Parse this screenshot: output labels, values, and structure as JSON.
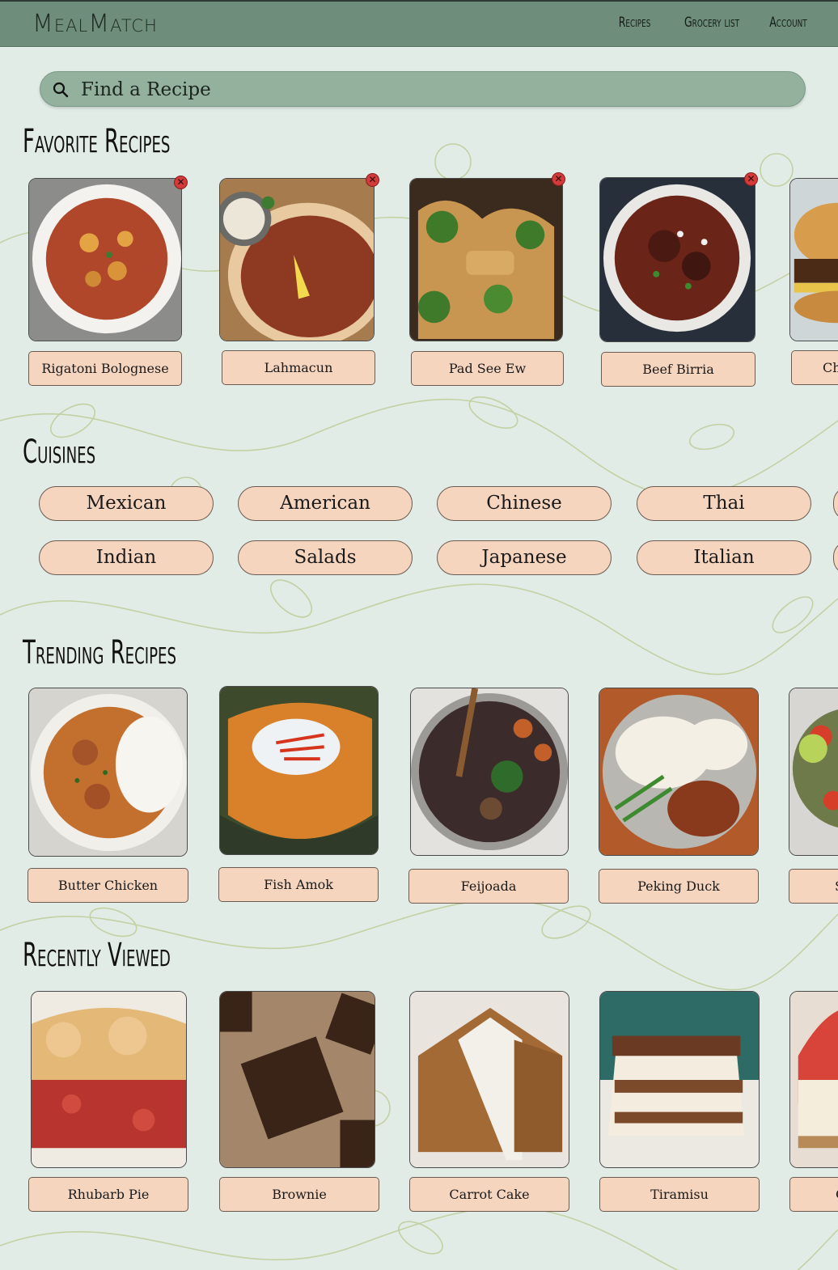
{
  "header": {
    "logo": "MealMatch",
    "nav": [
      "Recipes",
      "Grocery list",
      "Account"
    ]
  },
  "search": {
    "placeholder": "Find a Recipe",
    "icon": "search-icon"
  },
  "favorites": {
    "title": "Favorite Recipes",
    "items": [
      {
        "label": "Rigatoni Bolognese"
      },
      {
        "label": "Lahmacun"
      },
      {
        "label": "Pad See Ew"
      },
      {
        "label": "Beef Birria"
      },
      {
        "label": "Ch"
      }
    ]
  },
  "cuisines": {
    "title": "Cuisines",
    "row1": [
      "Mexican",
      "American",
      "Chinese",
      "Thai"
    ],
    "row2": [
      "Indian",
      "Salads",
      "Japanese",
      "Italian"
    ]
  },
  "trending": {
    "title": "Trending Recipes",
    "items": [
      {
        "label": "Butter Chicken"
      },
      {
        "label": "Fish Amok"
      },
      {
        "label": "Feijoada"
      },
      {
        "label": "Peking Duck"
      },
      {
        "label": "S"
      }
    ]
  },
  "recent": {
    "title": "Recently Viewed",
    "items": [
      {
        "label": "Rhubarb Pie"
      },
      {
        "label": "Brownie"
      },
      {
        "label": "Carrot Cake"
      },
      {
        "label": "Tiramisu"
      },
      {
        "label": "C"
      }
    ]
  },
  "colors": {
    "header_bg": "#6e8d7a",
    "search_bg": "#93b19d",
    "page_bg": "#e2ece6",
    "label_bg": "#f6d5bf",
    "remove_badge": "#d33a3a"
  }
}
